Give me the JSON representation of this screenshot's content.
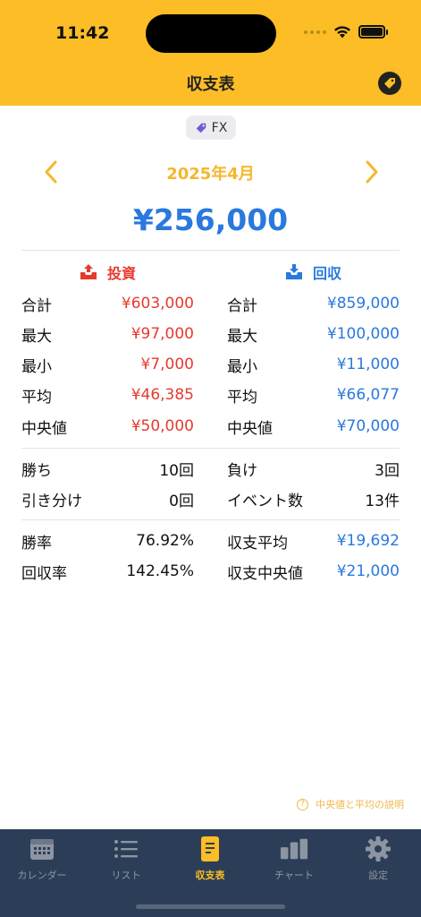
{
  "status": {
    "time": "11:42"
  },
  "nav": {
    "title": "収支表"
  },
  "filter_chip": {
    "label": "FX"
  },
  "month": {
    "label": "2025年4月"
  },
  "total": "¥256,000",
  "invest": {
    "header": "投資",
    "rows": [
      {
        "label": "合計",
        "value": "¥603,000"
      },
      {
        "label": "最大",
        "value": "¥97,000"
      },
      {
        "label": "最小",
        "value": "¥7,000"
      },
      {
        "label": "平均",
        "value": "¥46,385"
      },
      {
        "label": "中央値",
        "value": "¥50,000"
      }
    ]
  },
  "recover": {
    "header": "回収",
    "rows": [
      {
        "label": "合計",
        "value": "¥859,000"
      },
      {
        "label": "最大",
        "value": "¥100,000"
      },
      {
        "label": "最小",
        "value": "¥11,000"
      },
      {
        "label": "平均",
        "value": "¥66,077"
      },
      {
        "label": "中央値",
        "value": "¥70,000"
      }
    ]
  },
  "record": {
    "wins_label": "勝ち",
    "wins_value": "10回",
    "losses_label": "負け",
    "losses_value": "3回",
    "draws_label": "引き分け",
    "draws_value": "0回",
    "events_label": "イベント数",
    "events_value": "13件"
  },
  "rates": {
    "win_rate_label": "勝率",
    "win_rate_value": "76.92%",
    "balance_avg_label": "収支平均",
    "balance_avg_value": "¥19,692",
    "return_rate_label": "回収率",
    "return_rate_value": "142.45%",
    "balance_median_label": "収支中央値",
    "balance_median_value": "¥21,000"
  },
  "help": {
    "label": "中央値と平均の説明"
  },
  "tabs": [
    {
      "label": "カレンダー",
      "icon": "calendar-icon"
    },
    {
      "label": "リスト",
      "icon": "list-icon"
    },
    {
      "label": "収支表",
      "icon": "document-icon",
      "active": true
    },
    {
      "label": "チャート",
      "icon": "bar-chart-icon"
    },
    {
      "label": "設定",
      "icon": "gear-icon"
    }
  ],
  "colors": {
    "accent": "#fcbd26",
    "invest": "#e63a2e",
    "recover": "#2979de",
    "tabbar": "#2c3e57"
  }
}
